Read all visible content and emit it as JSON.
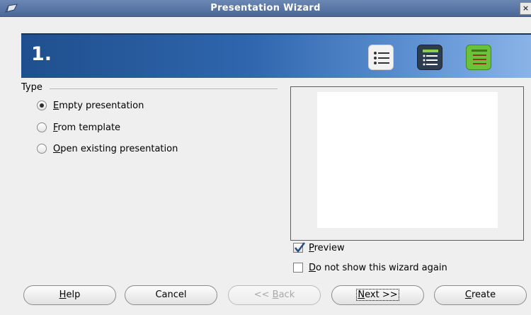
{
  "window": {
    "title": "Presentation Wizard",
    "close_glyph": "×"
  },
  "banner": {
    "step": "1."
  },
  "type_group": {
    "label": "Type",
    "options": [
      {
        "mn": "E",
        "rest": "mpty presentation",
        "selected": true
      },
      {
        "mn": "F",
        "rest": "rom template",
        "selected": false
      },
      {
        "mn": "O",
        "rest": "pen existing presentation",
        "selected": false
      }
    ]
  },
  "preview": {
    "mn": "P",
    "rest": "review",
    "checked": true
  },
  "dont_show": {
    "mn": "D",
    "rest": "o not show this wizard again",
    "checked": false
  },
  "buttons": {
    "help": {
      "mn": "H",
      "rest": "elp"
    },
    "cancel": {
      "label": "Cancel"
    },
    "back": {
      "pre": "<< ",
      "mn": "B",
      "rest": "ack",
      "enabled": false
    },
    "next": {
      "mn": "N",
      "rest": "ext >>",
      "focused": true
    },
    "create": {
      "mn": "C",
      "rest": "reate"
    }
  },
  "colors": {
    "titlebar": "#5a77a6",
    "banner_dark": "#1f4f8e",
    "banner_light": "#8ab4e8"
  },
  "icons": [
    "app-icon",
    "close-icon",
    "list-icon-plain",
    "list-icon-dark",
    "list-icon-green",
    "checkmark-icon"
  ]
}
